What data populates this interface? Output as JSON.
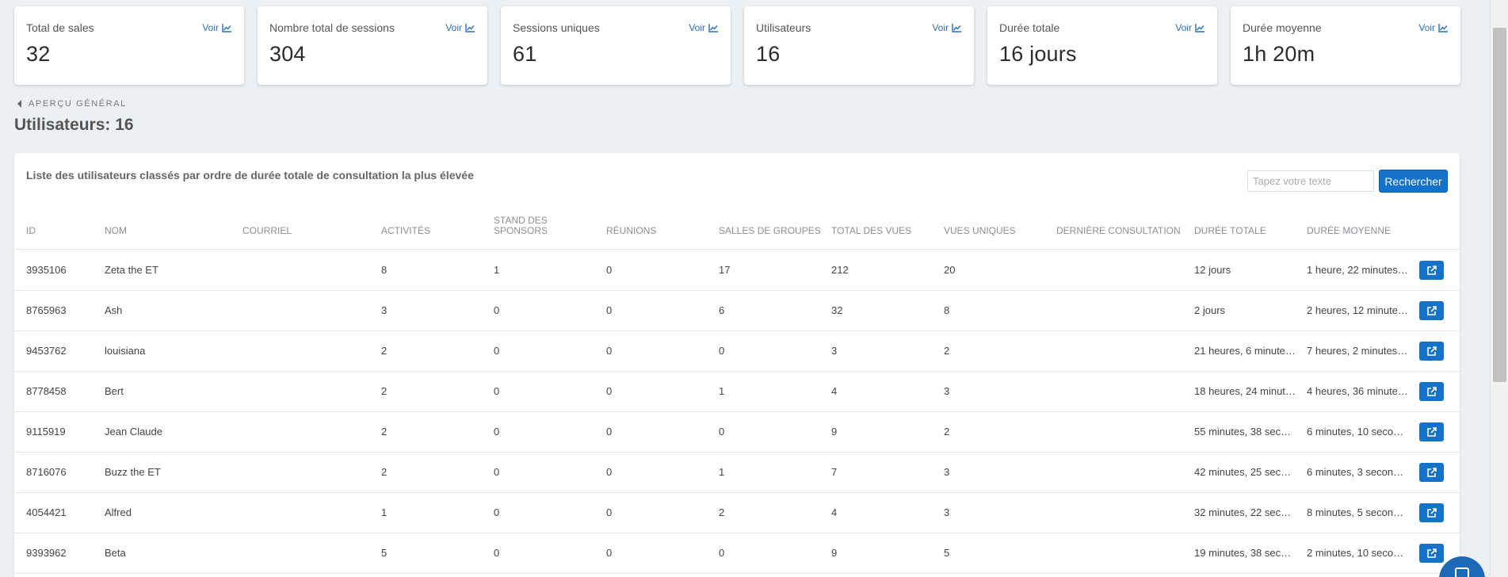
{
  "cards": [
    {
      "label": "Total de sales",
      "value": "32",
      "link": "Voir"
    },
    {
      "label": "Nombre total de sessions",
      "value": "304",
      "link": "Voir"
    },
    {
      "label": "Sessions uniques",
      "value": "61",
      "link": "Voir"
    },
    {
      "label": "Utilisateurs",
      "value": "16",
      "link": "Voir"
    },
    {
      "label": "Durée totale",
      "value": "16 jours",
      "link": "Voir"
    },
    {
      "label": "Durée moyenne",
      "value": "1h 20m",
      "link": "Voir"
    }
  ],
  "breadcrumb": "APERÇU GÉNÉRAL",
  "page_title": "Utilisateurs: 16",
  "panel": {
    "description": "Liste des utilisateurs classés par ordre de durée totale de consultation la plus élevée",
    "search_placeholder": "Tapez votre texte",
    "search_button": "Rechercher"
  },
  "table": {
    "headers": {
      "id": "ID",
      "nom": "NOM",
      "courriel": "COURRIEL",
      "activites": "ACTIVITÉS",
      "stand": "STAND DES SPONSORS",
      "reunions": "RÉUNIONS",
      "salles": "SALLES DE GROUPES",
      "total_vues": "TOTAL DES VUES",
      "vues_uniques": "VUES UNIQUES",
      "derniere": "DERNIÈRE CONSULTATION",
      "duree_totale": "DURÉE TOTALE",
      "duree_moyenne": "DURÉE MOYENNE"
    },
    "rows": [
      {
        "id": "3935106",
        "nom": "Zeta the ET",
        "courriel": "",
        "activites": "8",
        "stand": "1",
        "reunions": "0",
        "salles": "17",
        "total_vues": "212",
        "vues_uniques": "20",
        "derniere": "",
        "duree_totale": "12 jours",
        "duree_moyenne": "1 heure, 22 minutes, 4..."
      },
      {
        "id": "8765963",
        "nom": "Ash",
        "courriel": "",
        "activites": "3",
        "stand": "0",
        "reunions": "0",
        "salles": "6",
        "total_vues": "32",
        "vues_uniques": "8",
        "derniere": "",
        "duree_totale": "2 jours",
        "duree_moyenne": "2 heures, 12 minutes, ..."
      },
      {
        "id": "9453762",
        "nom": "louisiana",
        "courriel": "",
        "activites": "2",
        "stand": "0",
        "reunions": "0",
        "salles": "0",
        "total_vues": "3",
        "vues_uniques": "2",
        "derniere": "",
        "duree_totale": "21 heures, 6 minutes, ...",
        "duree_moyenne": "7 heures, 2 minutes, 1..."
      },
      {
        "id": "8778458",
        "nom": "Bert",
        "courriel": "",
        "activites": "2",
        "stand": "0",
        "reunions": "0",
        "salles": "1",
        "total_vues": "4",
        "vues_uniques": "3",
        "derniere": "",
        "duree_totale": "18 heures, 24 minutes...",
        "duree_moyenne": "4 heures, 36 minutes, ..."
      },
      {
        "id": "9115919",
        "nom": "Jean Claude",
        "courriel": "",
        "activites": "2",
        "stand": "0",
        "reunions": "0",
        "salles": "0",
        "total_vues": "9",
        "vues_uniques": "2",
        "derniere": "",
        "duree_totale": "55 minutes, 38 secon...",
        "duree_moyenne": "6 minutes, 10 secondes"
      },
      {
        "id": "8716076",
        "nom": "Buzz the ET",
        "courriel": "",
        "activites": "2",
        "stand": "0",
        "reunions": "0",
        "salles": "1",
        "total_vues": "7",
        "vues_uniques": "3",
        "derniere": "",
        "duree_totale": "42 minutes, 25 secon...",
        "duree_moyenne": "6 minutes, 3 secondes"
      },
      {
        "id": "4054421",
        "nom": "Alfred",
        "courriel": "",
        "activites": "1",
        "stand": "0",
        "reunions": "0",
        "salles": "2",
        "total_vues": "4",
        "vues_uniques": "3",
        "derniere": "",
        "duree_totale": "32 minutes, 22 secon...",
        "duree_moyenne": "8 minutes, 5 secondes"
      },
      {
        "id": "9393962",
        "nom": "Beta",
        "courriel": "",
        "activites": "5",
        "stand": "0",
        "reunions": "0",
        "salles": "0",
        "total_vues": "9",
        "vues_uniques": "5",
        "derniere": "",
        "duree_totale": "19 minutes, 38 secon...",
        "duree_moyenne": "2 minutes, 10 secondes"
      }
    ]
  },
  "colors": {
    "accent": "#1572c9",
    "link": "#2a6ebb",
    "background": "#edf0f2"
  },
  "icons": {
    "card_link": "chart-line-icon",
    "row_action": "external-link-icon",
    "breadcrumb": "caret-left-icon",
    "chat": "chat-icon"
  }
}
